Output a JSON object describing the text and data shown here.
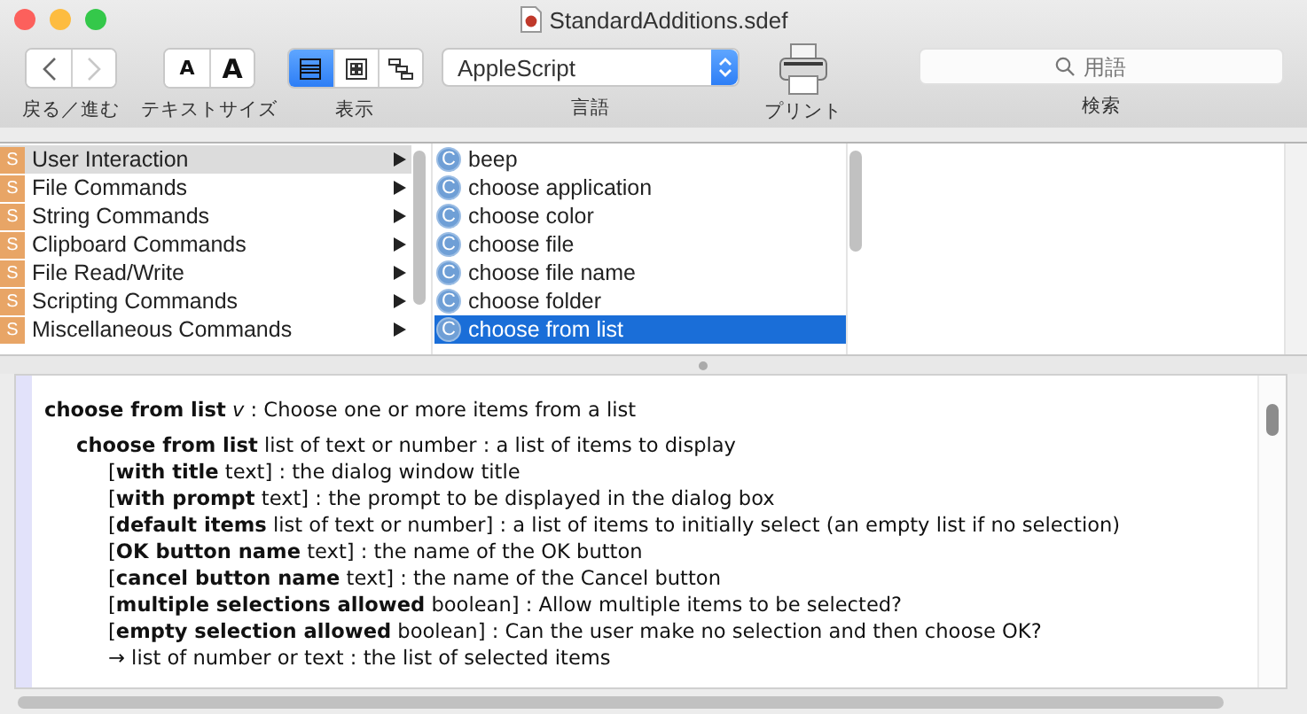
{
  "window": {
    "title": "StandardAdditions.sdef"
  },
  "toolbar": {
    "navigation": {
      "label": "戻る／進む",
      "back_disabled": false,
      "forward_disabled": true
    },
    "text_size": {
      "label": "テキストサイズ",
      "buttons": [
        "A",
        "A"
      ]
    },
    "view": {
      "label": "表示",
      "buttons": [
        {
          "kind": "list",
          "selected": true
        },
        {
          "kind": "grid",
          "selected": false
        },
        {
          "kind": "hierarchy",
          "selected": false
        }
      ]
    },
    "language": {
      "label": "言語",
      "value": "AppleScript"
    },
    "print": {
      "label": "プリント"
    },
    "search": {
      "label": "検索",
      "placeholder": "用語"
    }
  },
  "suites": [
    {
      "badge": "S",
      "label": "User Interaction",
      "selected": true
    },
    {
      "badge": "S",
      "label": "File Commands",
      "selected": false
    },
    {
      "badge": "S",
      "label": "String Commands",
      "selected": false
    },
    {
      "badge": "S",
      "label": "Clipboard Commands",
      "selected": false
    },
    {
      "badge": "S",
      "label": "File Read/Write",
      "selected": false
    },
    {
      "badge": "S",
      "label": "Scripting Commands",
      "selected": false
    },
    {
      "badge": "S",
      "label": "Miscellaneous Commands",
      "selected": false
    }
  ],
  "commands": [
    {
      "badge": "C",
      "label": "beep",
      "selected": false
    },
    {
      "badge": "C",
      "label": "choose application",
      "selected": false
    },
    {
      "badge": "C",
      "label": "choose color",
      "selected": false
    },
    {
      "badge": "C",
      "label": "choose file",
      "selected": false
    },
    {
      "badge": "C",
      "label": "choose file name",
      "selected": false
    },
    {
      "badge": "C",
      "label": "choose folder",
      "selected": false
    },
    {
      "badge": "C",
      "label": "choose from list",
      "selected": true
    }
  ],
  "documentation": {
    "text": "**choose from list** *v* : Choose one or more items from a list",
    "children": [
      {
        "text": "**choose from list** list of text or number : a list of items to display",
        "children": [
          {
            "text": "[**with title** text] : the dialog window title"
          },
          {
            "text": "[**with prompt** text] : the prompt to be displayed in the dialog box"
          },
          {
            "text": "[**default items** list of text or number] : a list of items to initially select (an empty list if no selection)"
          },
          {
            "text": "[**OK button name** text] : the name of the OK button"
          },
          {
            "text": "[**cancel button name** text] : the name of the Cancel button"
          },
          {
            "text": "[**multiple selections allowed** boolean] : Allow multiple items to be selected?"
          },
          {
            "text": "[**empty selection allowed** boolean] : Can the user make no selection and then choose OK?"
          },
          {
            "text": "→ list of number or text : the list of selected items"
          }
        ]
      }
    ]
  }
}
